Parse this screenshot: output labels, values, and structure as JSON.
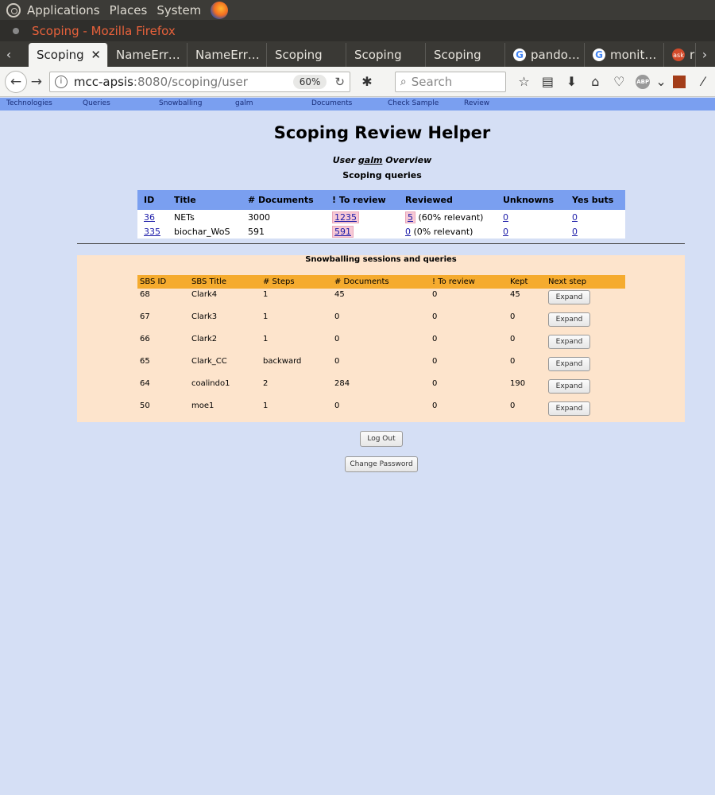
{
  "os_panel": {
    "menus": [
      "Applications",
      "Places",
      "System"
    ]
  },
  "window": {
    "title": "Scoping - Mozilla Firefox"
  },
  "tabs": [
    {
      "label": "Scoping",
      "active": true,
      "icon": "none"
    },
    {
      "label": "NameErr…",
      "icon": "none"
    },
    {
      "label": "NameErr…",
      "icon": "none"
    },
    {
      "label": "Scoping",
      "icon": "none"
    },
    {
      "label": "Scoping",
      "icon": "none"
    },
    {
      "label": "Scoping",
      "icon": "none"
    },
    {
      "label": "pando…",
      "icon": "google-icon"
    },
    {
      "label": "monit…",
      "icon": "google-icon"
    },
    {
      "label": "r",
      "icon": "ask-icon"
    }
  ],
  "tab_close": "✕",
  "navbar": {
    "url_host": "mcc-apsis",
    "url_path": ":8080/scoping/user",
    "zoom": "60%",
    "search_placeholder": "Search"
  },
  "site_nav": [
    "Technologies",
    "Queries",
    "Snowballing",
    "galm",
    "Documents",
    "Check Sample",
    "Review"
  ],
  "page": {
    "title": "Scoping Review Helper",
    "user_prefix": "User ",
    "user_name": "galm",
    "user_suffix": " Overview",
    "scoping_heading": "Scoping queries"
  },
  "scoping_table": {
    "headers": [
      "ID",
      "Title",
      "# Documents",
      "! To review",
      "Reviewed",
      "Unknowns",
      "Yes buts"
    ],
    "rows": [
      {
        "id": "36",
        "title": "NETs",
        "docs": "3000",
        "to_review": "1235",
        "reviewed": "5",
        "relevant": " (60% relevant)",
        "unknowns": "0",
        "yes_buts": "0"
      },
      {
        "id": "335",
        "title": "biochar_WoS",
        "docs": "591",
        "to_review": "591",
        "reviewed": "0",
        "relevant": " (0% relevant)",
        "unknowns": "0",
        "yes_buts": "0"
      }
    ]
  },
  "sbs": {
    "heading": "Snowballing sessions and queries",
    "headers": [
      "SBS ID",
      "SBS Title",
      "# Steps",
      "# Documents",
      "! To review",
      "Kept",
      "Next step"
    ],
    "expand_label": "Expand",
    "rows": [
      {
        "id": "68",
        "title": "Clark4",
        "steps": "1",
        "docs": "45",
        "to_review": "0",
        "kept": "45"
      },
      {
        "id": "67",
        "title": "Clark3",
        "steps": "1",
        "docs": "0",
        "to_review": "0",
        "kept": "0"
      },
      {
        "id": "66",
        "title": "Clark2",
        "steps": "1",
        "docs": "0",
        "to_review": "0",
        "kept": "0"
      },
      {
        "id": "65",
        "title": "Clark_CC",
        "steps": "backward",
        "docs": "0",
        "to_review": "0",
        "kept": "0"
      },
      {
        "id": "64",
        "title": "coalindo1",
        "steps": "2",
        "docs": "284",
        "to_review": "0",
        "kept": "190"
      },
      {
        "id": "50",
        "title": "moe1",
        "steps": "1",
        "docs": "0",
        "to_review": "0",
        "kept": "0"
      }
    ]
  },
  "buttons": {
    "logout": "Log Out",
    "change_password": "Change Password"
  }
}
